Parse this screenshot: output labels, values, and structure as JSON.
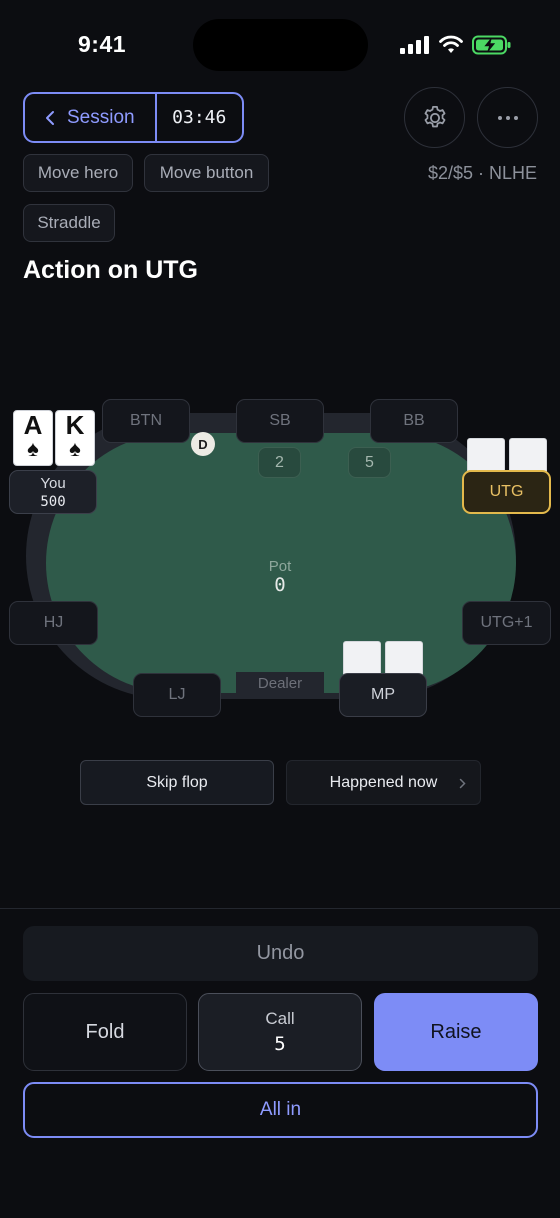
{
  "status_bar": {
    "time": "9:41",
    "icons": [
      "signal-icon",
      "wifi-icon",
      "battery-charging-icon"
    ]
  },
  "header": {
    "session_label": "Session",
    "timer": "03:46",
    "settings_icon": "gear-icon",
    "more_icon": "more-horizontal-icon",
    "stakes": "$2/$5 · NLHE"
  },
  "controls": {
    "move_hero": "Move hero",
    "move_button": "Move button",
    "straddle": "Straddle"
  },
  "action_title": "Action on UTG",
  "table": {
    "seats": {
      "btn": "BTN",
      "sb": "SB",
      "bb": "BB",
      "utg": "UTG",
      "utg1": "UTG+1",
      "mp": "MP",
      "lj": "LJ",
      "hj": "HJ",
      "hero": "You"
    },
    "hero_stack": "500",
    "hero_cards": [
      {
        "rank": "A",
        "suit": "♠"
      },
      {
        "rank": "K",
        "suit": "♠"
      }
    ],
    "bets": {
      "sb": "2",
      "bb": "5"
    },
    "dealer_button": "D",
    "pot_label": "Pot",
    "pot_value": "0",
    "dealer_label": "Dealer"
  },
  "mid_actions": {
    "skip_flop": "Skip flop",
    "happened_now": "Happened now"
  },
  "bottom_actions": {
    "undo": "Undo",
    "fold": "Fold",
    "call_label": "Call",
    "call_amount": "5",
    "raise": "Raise",
    "all_in": "All in"
  },
  "colors": {
    "accent": "#7d8cf6",
    "felt": "#2f5a4a",
    "active_seat": "#e3b94c",
    "background": "#0c0d11"
  }
}
